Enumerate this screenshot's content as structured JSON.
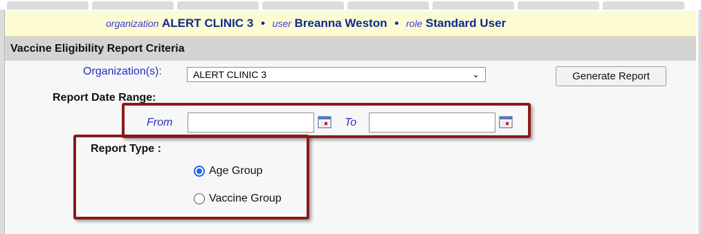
{
  "info_bar": {
    "organization_key": "organization",
    "organization_value": "ALERT CLINIC 3",
    "user_key": "user",
    "user_value": "Breanna Weston",
    "role_key": "role",
    "role_value": "Standard User",
    "separator": "•"
  },
  "section": {
    "title": "Vaccine Eligibility Report Criteria"
  },
  "form": {
    "organization_label": "Organization(s):",
    "organization_selected": "ALERT CLINIC 3",
    "generate_button": "Generate Report",
    "date_range_label": "Report Date Range:",
    "from_label": "From",
    "to_label": "To",
    "from_value": "",
    "to_value": "",
    "report_type_label": "Report Type :",
    "report_types": [
      {
        "label": "Age Group",
        "selected": true
      },
      {
        "label": "Vaccine Group",
        "selected": false
      }
    ]
  },
  "colors": {
    "highlight_box": "#8b1a1a",
    "info_bar_bg": "#fdfbd3",
    "label_blue": "#2a2ac8"
  },
  "icons": {
    "calendar": "calendar-icon",
    "dropdown": "chevron-down-icon"
  }
}
